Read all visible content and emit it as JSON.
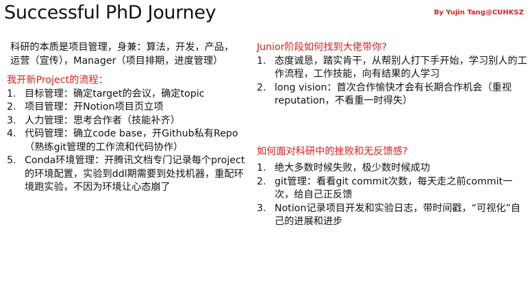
{
  "title": "Successful PhD Journey",
  "author": "By Yujin Tang@CUHKSZ",
  "intro": "科研的本质是项目管理，身兼：算法，开发，产品，运营（宣传），Manager（项目排期，进度管理）",
  "left_section": {
    "heading": "我开新Project的流程：",
    "items": [
      {
        "num": "1.",
        "text": "目标管理：确定target的会议，确定topic"
      },
      {
        "num": "2.",
        "text": "项目管理：开Notion项目页立项"
      },
      {
        "num": "3.",
        "text": "人力管理：思考合作者（技能补齐）"
      },
      {
        "num": "4.",
        "text": "代码管理：确立code base，开Github私有Repo（熟练git管理的工作流和代码协作）"
      },
      {
        "num": "5.",
        "text": "Conda环境管理：开腾讯文档专门记录每个project的环境配置，实验到ddl期需要到处找机器，重配环境跑实验，不因为环境让心态崩了"
      }
    ]
  },
  "right_section_1": {
    "heading": "Junior阶段如何找到大佬带你?",
    "items": [
      {
        "num": "1.",
        "text": "态度诚恳，踏实肯干，从帮别人打下手开始，学习别人的工作流程，工作技能，向有结果的人学习"
      },
      {
        "num": "2.",
        "text": "long vision：首次合作愉快才会有长期合作机会（重视reputation，不看重一时得失）"
      }
    ]
  },
  "right_section_2": {
    "heading": "如何面对科研中的挫败和无反馈感?",
    "items": [
      {
        "num": "1.",
        "text": "绝大多数时候失败，极少数时候成功"
      },
      {
        "num": "2.",
        "text": "git管理：看看git commit次数，每天走之前commit一次，给自己正反馈"
      },
      {
        "num": "3.",
        "text": "Notion记录项目开发和实验日志，带时间戳，“可视化”自己的进展和进步"
      }
    ]
  },
  "colors": {
    "heading": "#e21b1b",
    "author": "#e02020",
    "text": "#111111",
    "background": "#ffffff"
  }
}
